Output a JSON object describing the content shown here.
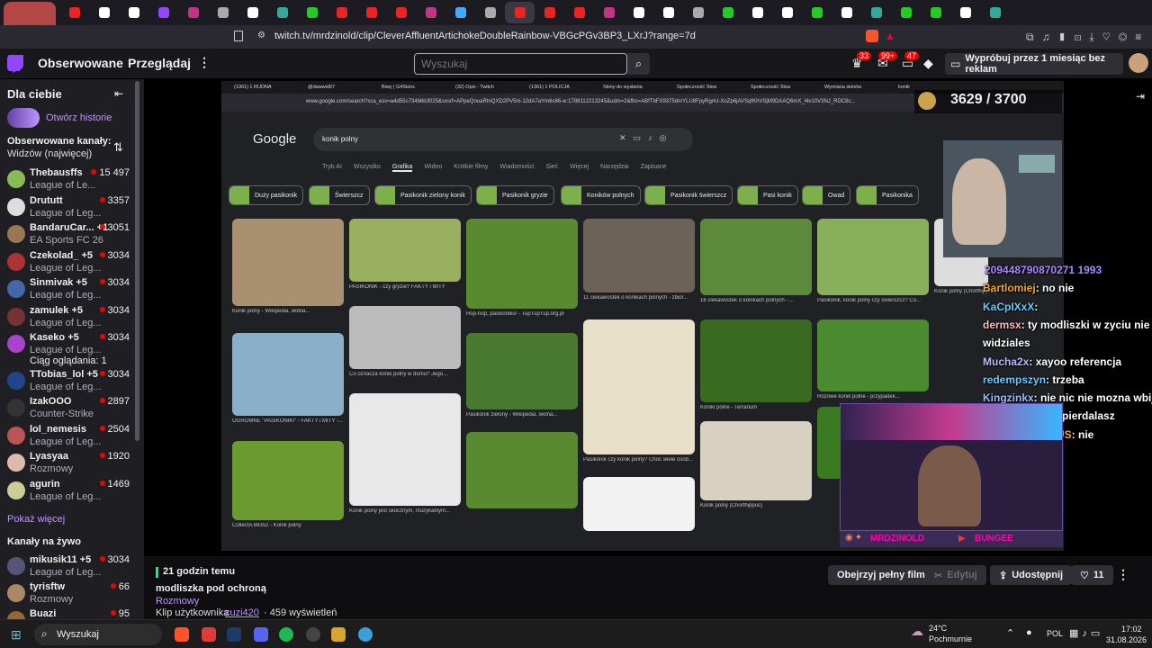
{
  "browser": {
    "url": "twitch.tv/mrdzinold/clip/CleverAffluentArtichokeDoubleRainbow-VBGcPGv3BP3_LXrJ?range=7d"
  },
  "twitch": {
    "nav_followed": "Obserwowane",
    "nav_browse": "Przeglądaj",
    "search_placeholder": "Wyszukaj",
    "badge_1": "33",
    "badge_2": "99+",
    "badge_3": "47",
    "promo": "Wypróbuj przez 1 miesiąc bez reklam"
  },
  "sidebar": {
    "title": "Dla ciebie",
    "open_stories": "Otwórz historie",
    "followed_header": "Obserwowane kanały:",
    "sort_label": "Widzów (najwięcej)",
    "show_more": "Pokaż więcej",
    "live_header": "Kanały na żywo",
    "channels": [
      {
        "name": "Thebausffs",
        "game": "League of Le...",
        "viewers": "15 497"
      },
      {
        "name": "Drututt",
        "game": "League of Leg...",
        "viewers": "3357"
      },
      {
        "name": "BandaruCar... +1",
        "game": "EA Sports FC 26",
        "viewers": "3051"
      },
      {
        "name": "Czekolad_ +5",
        "game": "League of Leg...",
        "viewers": "3034"
      },
      {
        "name": "Sinmivak +5",
        "game": "League of Leg...",
        "viewers": "3034"
      },
      {
        "name": "zamulek +5",
        "game": "League of Leg...",
        "viewers": "3034"
      },
      {
        "name": "Kaseko +5",
        "game": "League of Leg...",
        "viewers": "3034",
        "extra": "Ciąg oglądania: 1"
      },
      {
        "name": "TTobias_lol +5",
        "game": "League of Leg...",
        "viewers": "3034"
      },
      {
        "name": "IzakOOO",
        "game": "Counter-Strike",
        "viewers": "2897"
      },
      {
        "name": "lol_nemesis",
        "game": "League of Leg...",
        "viewers": "2504"
      },
      {
        "name": "Lyasyaa",
        "game": "Rozmowy",
        "viewers": "1920"
      },
      {
        "name": "agurin",
        "game": "League of Leg...",
        "viewers": "1469"
      }
    ],
    "live": [
      {
        "name": "mikusik11 +5",
        "game": "League of Leg...",
        "viewers": "3034"
      },
      {
        "name": "tyrisftw",
        "game": "Rozmowy",
        "viewers": "66"
      },
      {
        "name": "Buazi",
        "game": "",
        "viewers": "95"
      }
    ]
  },
  "stream": {
    "counter": "3629 / 3700",
    "overlay_name": "MRDZINOLD",
    "overlay_name2": "BUNGEE",
    "inner_search": "konik polny",
    "inner_url": "www.google.com/search?sca_esv=a4d55c734b6b3025&sxsrf=APpeQnuaRtnQXD2PV5m-12dA7aYm6c86-w:1788112213245&udm=2&fbs=ABfTbFX9375dmYLU8FpyRgnU-XoZp6jAVSqfKhVSjM9DAAQ6mX_l4v10V3NJ_RDC8c...",
    "inner_tabs": [
      "(1361) 1 RUDNA",
      "@dawwid97",
      "Biwy | G4Skins",
      "(32) Opis - Twitch",
      "(1361) 1 POLICJA",
      "Skiny do wysłania",
      "Społeczność Stea",
      "Społeczność Stea",
      "Wymiana skinów",
      "konik"
    ],
    "google_tabs": [
      "Tryb AI",
      "Wszystko",
      "Grafika",
      "Wideo",
      "Krótkie filmy",
      "Wiadomości",
      "Sieć",
      "Więcej",
      "Narzędzia",
      "Zapisane"
    ],
    "chips": [
      "Duży pasikonik",
      "Świerszcz",
      "Pasikonik zielony konik",
      "Pasikonik gryzie",
      "Koników polnych",
      "Pasikonik świerszcz",
      "Pasi konik",
      "Owad",
      "Pasikonika"
    ],
    "captions": [
      "Konik polny - Wikipedia, wolna...",
      "PASIKONIK - czy gryzie? FAKTY i MITY",
      "Hop-hop, pasikoniku! - TupTupTup.org.pl",
      "11 ciekawostek o konikach polnych - zbiór...",
      "16 ciekawostek o konikach polnych - ...",
      "Pasikonik, konik polny czy świerszcz? Co...",
      "Konik polny (Chorthippus)",
      "OGROMNE \"PASIKONIKI\" - FAKTY i MITY -...",
      "Co oznacza konik polny w domu? Jego...",
      "Pasikonik zielony - Wikipedia, wolna...",
      "Pasikonik czy konik polny? Choć wiele osób...",
      "Koniki polne - Terrarium",
      "Różowe konik polne - przypadek...",
      "CollectA 88352 - Konik polny",
      "Konik polny jest skocznym, muzykalnym...",
      "Konik polny (Chorthippus)"
    ],
    "chat": [
      {
        "user": "209448790870271 1993",
        "text": ""
      },
      {
        "user": "Bartlomiej",
        "text": ": no nie"
      },
      {
        "user": "KaCpIXxX",
        "text": ":"
      },
      {
        "user": "dermsx",
        "text": ": ty modliszki w zyciu nie"
      },
      {
        "user": "",
        "text": "widziales"
      },
      {
        "user": "Mucha2x",
        "text": ": xayoo referencja"
      },
      {
        "user": "redempszyn",
        "text": ": trzeba"
      },
      {
        "user": "Kingzinkx",
        "text": ": nie nic nie mozna wbija"
      },
      {
        "user": "",
        "text": "ci na chate i wypierdalasz"
      },
      {
        "user": "UMUS_MAXIMUS",
        "text": ": nie"
      }
    ]
  },
  "clip": {
    "time_ago": "21 godzin temu",
    "title": "modliszka pod ochroną",
    "category": "Rozmowy",
    "author_prefix": "Klip użytkownika",
    "author": "cuzi420",
    "views": "· 459 wyświetleń",
    "btn_watch": "Obejrzyj pełny film",
    "btn_edit": "Edytuj",
    "btn_share": "Udostępnij",
    "likes": "11"
  },
  "taskbar": {
    "search": "Wyszukaj",
    "weather_temp": "24°C",
    "weather_desc": "Pochmurnie",
    "lang": "POL",
    "time": "17:02",
    "date": "31.08.2026"
  }
}
